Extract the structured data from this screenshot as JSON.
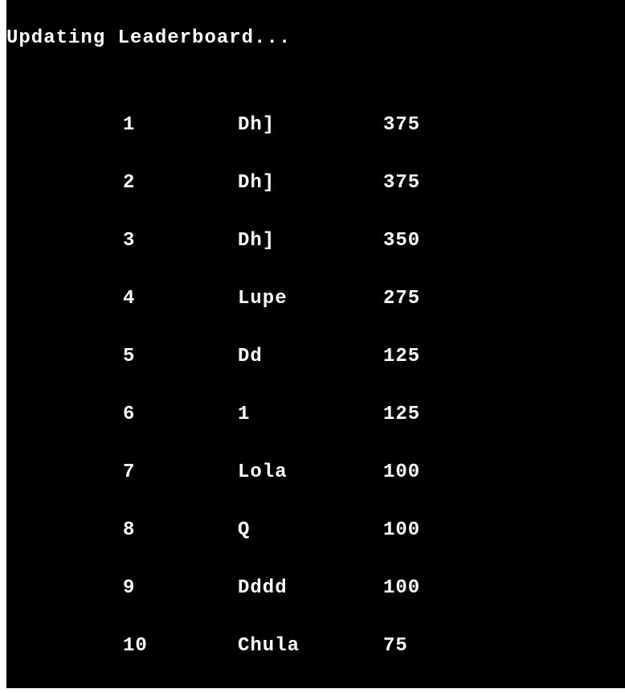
{
  "status_text": "Updating Leaderboard...",
  "leaderboard": [
    {
      "rank": "1",
      "name": "Dh]",
      "score": "375"
    },
    {
      "rank": "2",
      "name": "Dh]",
      "score": "375"
    },
    {
      "rank": "3",
      "name": "Dh]",
      "score": "350"
    },
    {
      "rank": "4",
      "name": "Lupe",
      "score": "275"
    },
    {
      "rank": "5",
      "name": "Dd",
      "score": "125"
    },
    {
      "rank": "6",
      "name": "1",
      "score": "125"
    },
    {
      "rank": "7",
      "name": "Lola",
      "score": "100"
    },
    {
      "rank": "8",
      "name": "Q",
      "score": "100"
    },
    {
      "rank": "9",
      "name": "Dddd",
      "score": "100"
    },
    {
      "rank": "10",
      "name": "Chula",
      "score": "75"
    }
  ],
  "colors": {
    "background": "#000000",
    "text": "#ffffff"
  }
}
